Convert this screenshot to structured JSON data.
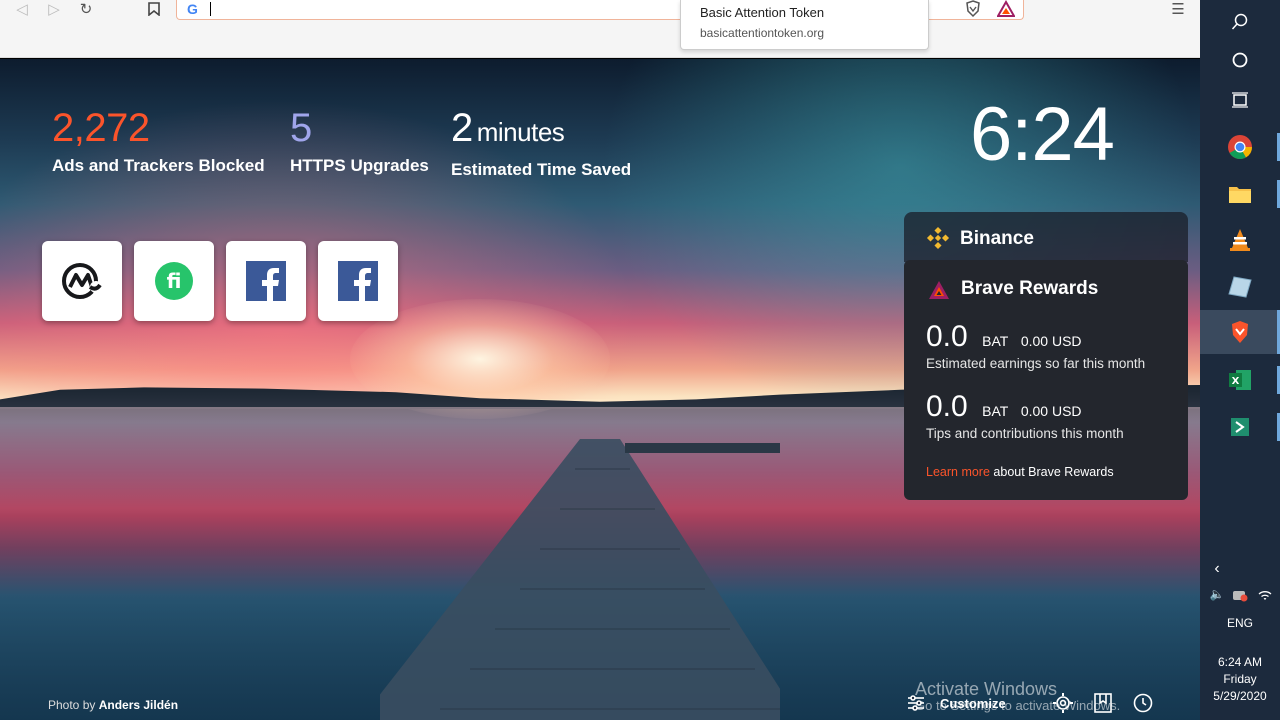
{
  "browser": {
    "address_value": "",
    "suggestion": {
      "title": "Basic Attention Token",
      "url": "basicattentiontoken.org"
    },
    "icons": [
      "back-icon",
      "forward-icon",
      "reload-icon",
      "bookmark-icon",
      "google-icon",
      "brave-shields-icon",
      "bat-icon",
      "menu-icon"
    ]
  },
  "stats": {
    "ads": {
      "value": "2,272",
      "label": "Ads and Trackers Blocked"
    },
    "https": {
      "value": "5",
      "label": "HTTPS Upgrades"
    },
    "time": {
      "value": "2",
      "unit": "minutes",
      "label": "Estimated Time Saved"
    }
  },
  "clock": "6:24",
  "top_sites": [
    "coinmarketcap-icon",
    "fi-icon",
    "facebook-icon",
    "facebook-icon"
  ],
  "binance": {
    "title": "Binance"
  },
  "rewards": {
    "title": "Brave Rewards",
    "earnings": {
      "amount": "0.0",
      "currency": "BAT",
      "usd": "0.00 USD",
      "desc": "Estimated earnings so far this month"
    },
    "tips": {
      "amount": "0.0",
      "currency": "BAT",
      "usd": "0.00 USD",
      "desc": "Tips and contributions this month"
    },
    "learn_link": "Learn more",
    "learn_rest": " about Brave Rewards"
  },
  "photo_credit": {
    "prefix": "Photo by ",
    "name": "Anders Jildén"
  },
  "customize_label": "Customize",
  "watermark": {
    "line1": "Activate Windows",
    "line2": "Go to Settings to activate Windows."
  },
  "taskbar": {
    "lang": "ENG",
    "time": "6:24 AM",
    "day": "Friday",
    "date": "5/29/2020"
  },
  "colors": {
    "accent": "#fb542b",
    "https": "#a0a5eb",
    "binance": "#f3ba2f"
  }
}
